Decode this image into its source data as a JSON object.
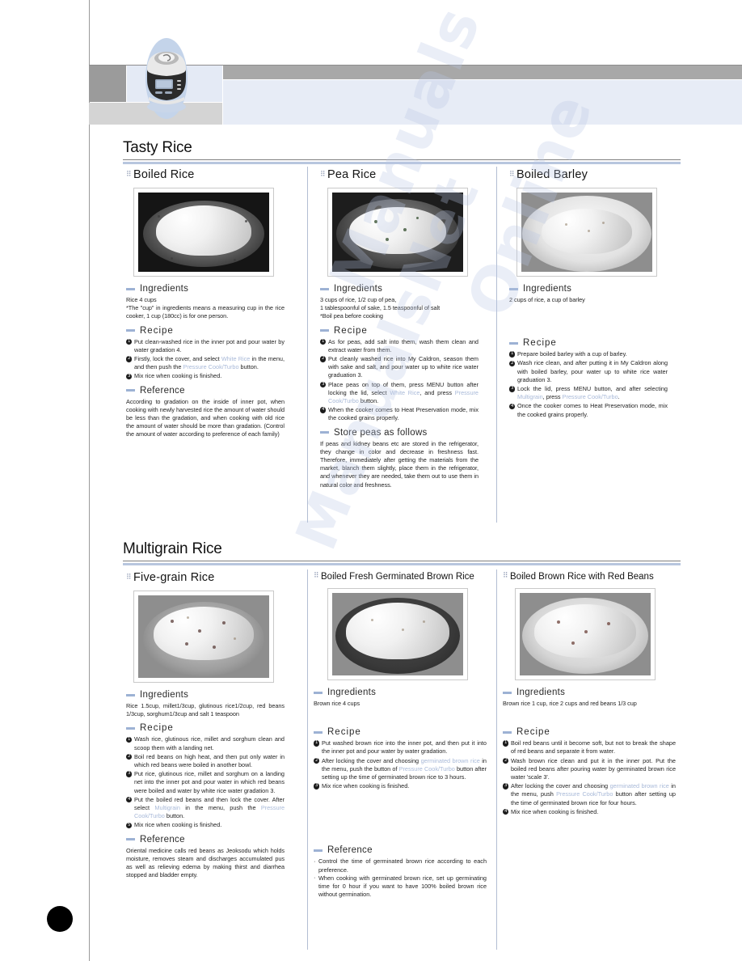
{
  "page": {
    "background_color": "#ffffff",
    "accent_color": "#9db2d4",
    "highlight_color": "#a8b9d8",
    "header_gray": "#9b9b9b",
    "header_blue": "#e7ecf6"
  },
  "watermark": {
    "words": [
      "Manuals",
      "Online",
      "ManualsNet"
    ]
  },
  "header": {
    "product_icon": "rice-cooker-icon"
  },
  "chapters": [
    {
      "title": "Tasty Rice",
      "recipes": [
        {
          "name": "Boiled Rice",
          "photo_caption": "boiled-white-rice-in-black-pot",
          "ingredients_label": "Ingredients",
          "ingredients": [
            "Rice 4 cups",
            "*The \"cup\" in ingredients means a measuring cup in the rice cooker, 1 cup (180cc) is for one person."
          ],
          "recipe_label": "Recipe",
          "steps": [
            "Put clean-washed rice in the inner pot and pour water by water gradation 4.",
            "Firstly, lock the cover, and select <hl>White Rice</hl> in the menu, and then push the <hl>Pressure Cook/Turbo</hl> button.",
            "Mix rice when cooking is finished."
          ],
          "reference_label": "Reference",
          "reference": [
            "According to gradation on the inside of inner pot, when cooking with newly harvested rice the amount of water should be less than the gradation, and when cooking with old rice the amount of water should be more than gradation. (Control the amount of water according to preference of each family)"
          ]
        },
        {
          "name": "Pea Rice",
          "photo_caption": "pea-rice-in-black-bowl",
          "ingredients_label": "Ingredients",
          "ingredients": [
            "3 cups of rice, 1/2 cup of pea,",
            "1 tablespoonful of sake, 1.5 teaspoonful of salt",
            "*Boil pea before cooking"
          ],
          "recipe_label": "Recipe",
          "steps": [
            "As for peas, add salt into them, wash them clean and extract water from them.",
            "Put cleanly washed rice into My Caldron, season them with sake and salt, and pour water up to white rice water graduation 3.",
            "Place peas on top of them, press MENU button after locking the lid, select <hl>White Rice</hl>, and press <hl>Pressure Cook/Turbo</hl> button.",
            "When the cooker comes to Heat Preservation mode, mix the cooked grains properly."
          ],
          "extra_label": "Store peas as follows",
          "extra": [
            "If peas and kidney beans etc are stored in the refrigerator, they change in color and decrease in freshness fast. Therefore, immediately after getting the materials from the market, blanch them slightly, place them in the refrigerator, and whenever they are needed, take them out to use them in natural color and freshness."
          ]
        },
        {
          "name": "Boiled Barley",
          "photo_caption": "boiled-barley-in-white-bowl",
          "ingredients_label": "Ingredients",
          "ingredients": [
            "2 cups of rice, a cup of barley"
          ],
          "recipe_label": "Recipe",
          "steps": [
            "Prepare boiled barley with a cup of barley.",
            "Wash rice clean, and after putting it in My Caldron along with boiled barley, pour water up to white rice water graduation 3.",
            "Lock the lid, press MENU button, and after selecting <hl>Multigrain</hl>, press <hl>Pressure Cook/Turbo</hl>.",
            "Once the cooker comes to Heat Preservation mode, mix the cooked grains properly."
          ]
        }
      ]
    },
    {
      "title": "Multigrain Rice",
      "recipes": [
        {
          "name": "Five-grain Rice",
          "photo_caption": "five-grain-rice-in-bowl",
          "ingredients_label": "Ingredients",
          "ingredients": [
            "Rice 1.5cup, millet1/3cup, glutinous rice1/2cup, red beans 1/3cup, sorghum1/3cup and salt 1 teaspoon"
          ],
          "recipe_label": "Recipe",
          "steps": [
            "Wash rice, glutinous rice, millet and sorghum clean and scoop them with a landing net.",
            "Boil red beans on high heat, and then put only water in which red beans were boiled in another bowl.",
            "Put rice, glutinous rice, millet and sorghum on a landing net into the inner pot and pour water in which red beans were boiled and water by white rice water gradation 3.",
            "Put the boiled red beans and then lock the cover. After select <hl>Multigrain</hl> in the menu, push the <hl>Pressure Cook/Turbo</hl> button.",
            "Mix rice when cooking is finished."
          ],
          "reference_label": "Reference",
          "reference": [
            "Oriental medicine calls red beans as Jeoksodu which holds moisture, removes steam and discharges accumulated pus as well as relieving edema by making thirst and diarrhea stopped and bladder empty."
          ]
        },
        {
          "name": "Boiled Fresh Germinated Brown Rice",
          "photo_caption": "germinated-brown-rice-in-bowl",
          "ingredients_label": "Ingredients",
          "ingredients": [
            "Brown rice 4 cups"
          ],
          "recipe_label": "Recipe",
          "steps": [
            "Put washed brown rice into the inner pot, and then put it into the inner pot and pour water by water gradation.",
            "After locking the cover and choosing <hl>germinated brown rice</hl> in the menu, push the button of <hl>Pressure Cook/Turbo</hl> button after setting up the time of germinated brown rice to 3 hours.",
            "Mix rice when cooking is finished."
          ],
          "reference_label": "Reference",
          "reference_items": [
            "Control the time of germinated brown rice according to each preference.",
            "When cooking with germinated brown rice, set up germinating time for 0 hour if you want to have 100% boiled brown rice without germination."
          ]
        },
        {
          "name": "Boiled Brown Rice with Red Beans",
          "photo_caption": "brown-rice-with-red-beans-in-bowl",
          "ingredients_label": "Ingredients",
          "ingredients": [
            "Brown rice 1 cup, rice 2 cups and red beans 1/3 cup"
          ],
          "recipe_label": "Recipe",
          "steps": [
            "Boil red beans until it become soft, but not to break the shape of red beans and separate it from water.",
            "Wash brown rice clean and put it in the inner pot. Put the boiled red beans after pouring water by germinated brown rice water 'scale 3'.",
            "After locking the cover and choosing <hl>germinated brown rice</hl> in the menu, push <hl>Pressure Cook/Turbo</hl> button after setting up the time of germinated brown rice for four hours.",
            "Mix rice when cooking is finished."
          ]
        }
      ]
    }
  ]
}
